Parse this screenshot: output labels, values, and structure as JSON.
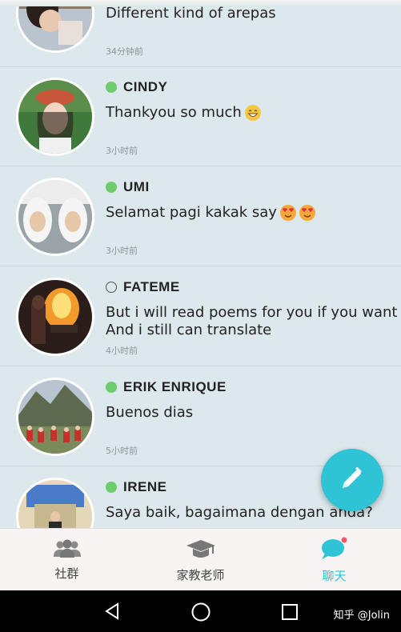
{
  "conversations": [
    {
      "name": "",
      "status": "",
      "message": "Different kind of arepas",
      "time": "34分钟前"
    },
    {
      "name": "CINDY",
      "status": "online",
      "message": "Thankyou so much",
      "emoji": "grin",
      "time": "3小时前"
    },
    {
      "name": "UMI",
      "status": "online",
      "message": "Selamat pagi kakak say",
      "emoji": "heart-eyes",
      "time": "3小时前"
    },
    {
      "name": "FATEME",
      "status": "offline",
      "message": "But i will read poems for you if you want\nAnd i still can translate",
      "time": "4小时前"
    },
    {
      "name": "ERIK ENRIQUE",
      "status": "online",
      "message": "Buenos dias",
      "time": "5小时前"
    },
    {
      "name": "IRENE",
      "status": "online",
      "message": "Saya baik, bagaimana dengan anda?",
      "time": ""
    }
  ],
  "tabs": [
    {
      "label": "社群",
      "icon": "community-icon"
    },
    {
      "label": "家教老师",
      "icon": "graduation-cap-icon"
    },
    {
      "label": "聊天",
      "icon": "chat-bubble-icon",
      "active": true
    }
  ],
  "fab": {
    "icon": "pencil-icon"
  },
  "watermark": "知乎 @Jolin",
  "colors": {
    "accent": "#2ec4d6",
    "online": "#6dcc6d",
    "background": "#dce8ec"
  }
}
